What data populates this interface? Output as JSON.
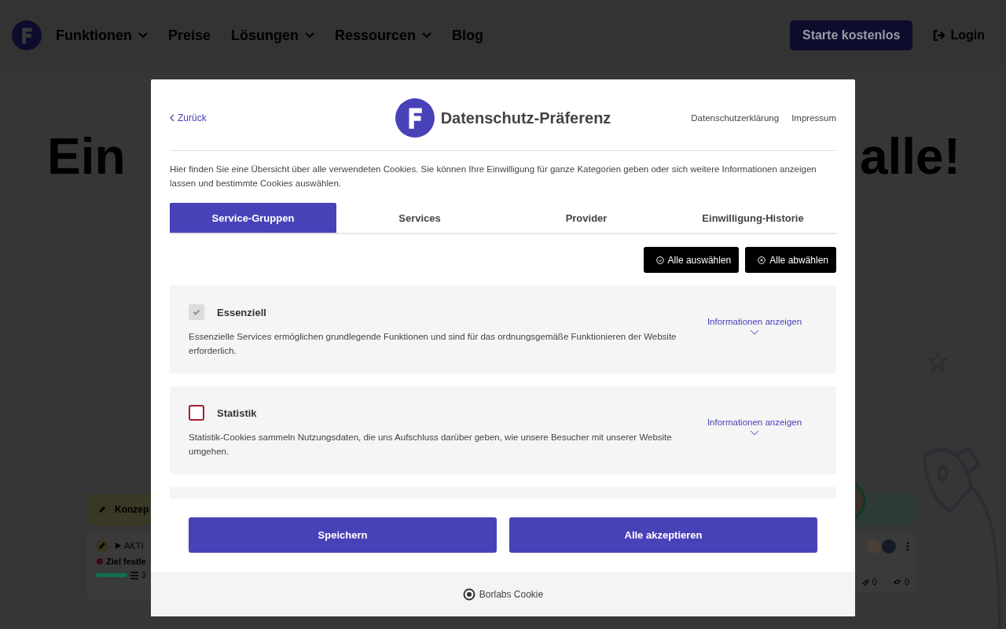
{
  "site_header": {
    "nav": [
      {
        "label": "Funktionen",
        "has_dropdown": true
      },
      {
        "label": "Preise",
        "has_dropdown": false
      },
      {
        "label": "Lösungen",
        "has_dropdown": true
      },
      {
        "label": "Ressourcen",
        "has_dropdown": true
      },
      {
        "label": "Blog",
        "has_dropdown": false
      }
    ],
    "cta": "Starte kostenlos",
    "login": "Login"
  },
  "hero": {
    "heading_start": "Ein",
    "heading_end": "alle!"
  },
  "board": {
    "column_header": "Konzep",
    "card": {
      "status": "AKTI",
      "task": "Ziel festle",
      "progress": {
        "level": 1
      },
      "checklist_count": "3"
    },
    "right_card": {
      "attachments": "0",
      "links": "0"
    }
  },
  "privacy_modal": {
    "back_link": "Zurück",
    "title": "Datenschutz-Präferenz",
    "links": [
      "Datenschutzerklärung",
      "Impressum"
    ],
    "description": "Hier finden Sie eine Übersicht über alle verwendeten Cookies. Sie können Ihre Einwilligung für ganze Kategorien geben oder sich weitere Informationen anzeigen lassen und bestimmte Cookies auswählen.",
    "tabs": [
      {
        "label": "Service-Gruppen",
        "selected": true
      },
      {
        "label": "Services",
        "selected": false
      },
      {
        "label": "Provider",
        "selected": false
      },
      {
        "label": "Einwilligung-Historie",
        "selected": false
      }
    ],
    "bulk_buttons": [
      {
        "label": "Alle auswählen",
        "kind": "select"
      },
      {
        "label": "Alle abwählen",
        "kind": "deselect"
      }
    ],
    "groups": [
      {
        "name": "Essenziell",
        "checked": true,
        "disabled": true,
        "description": "Essenzielle Services ermöglichen grundlegende Funktionen und sind für das ordnungsgemäße Funktionieren der Website erforderlich.",
        "info_link": "Informationen anzeigen"
      },
      {
        "name": "Statistik",
        "checked": false,
        "disabled": false,
        "description": "Statistik-Cookies sammeln Nutzungsdaten, die uns Aufschluss darüber geben, wie unsere Besucher mit unserer Website umgehen.",
        "info_link": "Informationen anzeigen"
      }
    ],
    "footer_buttons": [
      "Speichern",
      "Alle akzeptieren"
    ],
    "branding": "Borlabs Cookie"
  }
}
